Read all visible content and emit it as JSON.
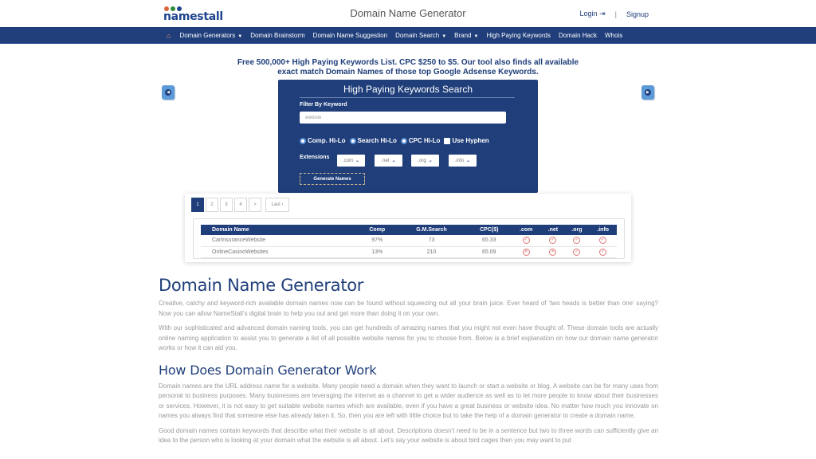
{
  "header": {
    "logo_text": "namestall",
    "logo_dot_colors": [
      "#d9643a",
      "#2e8b3c",
      "#1f4590"
    ],
    "site_title": "Domain Name Generator",
    "login_label": "Login",
    "login_icon": "⇥",
    "separator": "|",
    "signup_label": "Signup"
  },
  "nav": {
    "home_icon": "⌂",
    "items": [
      {
        "label": "Domain Generators",
        "dropdown": true
      },
      {
        "label": "Domain Brainstorm",
        "dropdown": false
      },
      {
        "label": "Domain Name Suggestion",
        "dropdown": false
      },
      {
        "label": "Domain Search",
        "dropdown": true
      },
      {
        "label": "Brand",
        "dropdown": true
      },
      {
        "label": "High Paying Keywords",
        "dropdown": false
      },
      {
        "label": "Domain Hack",
        "dropdown": false
      },
      {
        "label": "Whois",
        "dropdown": false
      }
    ],
    "caret": "▼"
  },
  "banner": {
    "line1": "Free 500,000+ High Paying Keywords List. CPC $250 to $5. Our tool also finds all available",
    "line2": "exact match Domain Names of those top Google Adsense Keywords."
  },
  "carousel": {
    "prev_icon": "◀",
    "next_icon": "▶"
  },
  "search_panel": {
    "title": "High Paying Keywords Search",
    "filter_label": "Filter By Keyword",
    "keyword_value": "website",
    "options": [
      "Comp. Hi-Lo",
      "Search Hi-Lo",
      "CPC Hi-Lo"
    ],
    "hyphen_label": "Use Hyphen",
    "extensions_label": "Extensions",
    "extensions": [
      ".com",
      ".net",
      ".org",
      ".info"
    ],
    "chevron": "❯",
    "generate_label": "Generate Names"
  },
  "pagination": {
    "pages": [
      "1",
      "2",
      "3",
      "4",
      ">"
    ],
    "last_label": "Last ›",
    "active_page": "1"
  },
  "results": {
    "columns": [
      "Domain Name",
      "Comp",
      "G.M.Search",
      "CPC($)",
      ".com",
      ".net",
      ".org",
      ".info"
    ],
    "rows": [
      {
        "name": "CarInsuranceWebsite",
        "comp": "97%",
        "search": "73",
        "cpc": "65.33",
        "status": [
          "available",
          "available",
          "available",
          "available"
        ]
      },
      {
        "name": "OnlineCasinoWebsites",
        "comp": "13%",
        "search": "210",
        "cpc": "65.09",
        "status": [
          "taken",
          "taken",
          "available",
          "available"
        ]
      }
    ],
    "icons": {
      "available": "✓",
      "taken": "✕"
    },
    "status_color": "#e07676"
  },
  "article": {
    "heading": "Domain Name Generator",
    "intro_p1": "Creative, catchy and keyword-rich available domain names now can be found without squeezing out all your brain juice. Ever heard of ‘two heads is better than one’ saying? Now you can allow NameStall’s digital brain to help you out and get more than doing it on your own.",
    "intro_p2": "With our sophisticated and advanced domain naming tools, you can get hundreds of amazing names that you might not even have thought of. These domain tools are actually online naming application to assist you to generate a list of all possible website names for you to choose from. Below is a brief explanation on how our domain name generator works or how it can aid you.",
    "subheading": "How Does Domain Generator Work",
    "body_p1": "Domain names are the URL address name for a website. Many people need a domain when they want to launch or start a website or blog. A website can be for many uses from personal to business purposes. Many businesses are leveraging the internet as a channel to get a wider audience as well as to let more people to know about their businesses or services. However, it is not easy to get suitable website names which are available, even if you have a great business or website idea. No matter how much you innovate on names you always find that someone else has already taken it. So, then you are left with little choice but to take the help of a domain generator to create a domain name.",
    "body_p2": "Good domain names contain keywords that describe what their website is all about. Descriptions doesn’t need to be in a sentence but two to three words can sufficiently give an idea to the person who is looking at your domain what the website is all about. Let’s say your website is about bird cages then you may want to put"
  }
}
